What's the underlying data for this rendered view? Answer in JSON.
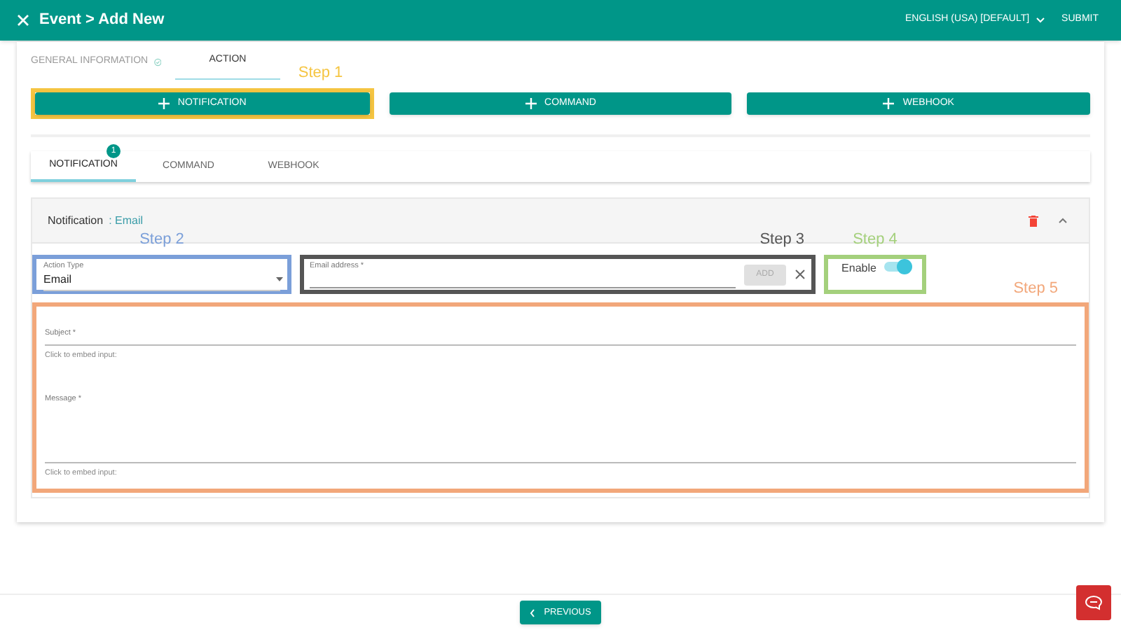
{
  "header": {
    "title": "Event > Add New",
    "language": "ENGLISH (USA) [DEFAULT]",
    "submit": "SUBMIT"
  },
  "top_tabs": [
    {
      "label": "GENERAL INFORMATION",
      "selected": false,
      "done": true
    },
    {
      "label": "ACTION",
      "selected": true,
      "done": false
    }
  ],
  "add_buttons": [
    {
      "label": "NOTIFICATION"
    },
    {
      "label": "COMMAND"
    },
    {
      "label": "WEBHOOK"
    }
  ],
  "action_tabs": [
    {
      "label": "NOTIFICATION",
      "selected": true,
      "badge": "1"
    },
    {
      "label": "COMMAND",
      "selected": false
    },
    {
      "label": "WEBHOOK",
      "selected": false
    }
  ],
  "panel": {
    "title": "Notification",
    "subtitle": ": Email",
    "expanded": true,
    "action_type": {
      "label": "Action Type",
      "value": "Email"
    },
    "email": {
      "label": "Email address *",
      "add": "ADD"
    },
    "enable": {
      "label": "Enable",
      "on": true
    },
    "subject": {
      "label": "Subject *",
      "hint": "Click to embed input:"
    },
    "message": {
      "label": "Message *",
      "hint": "Click to embed input:"
    }
  },
  "annotations": [
    {
      "label": "Step 1",
      "color": "#f5c542"
    },
    {
      "label": "Step 2",
      "color": "#7b9fd9"
    },
    {
      "label": "Step 3",
      "color": "#555555"
    },
    {
      "label": "Step 4",
      "color": "#a4d07c"
    },
    {
      "label": "Step 5",
      "color": "#f2a77a"
    }
  ],
  "footer": {
    "previous": "PREVIOUS"
  }
}
